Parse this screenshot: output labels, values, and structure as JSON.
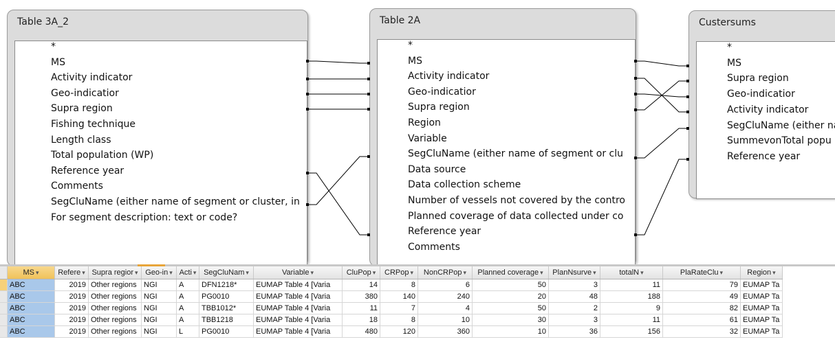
{
  "tables": [
    {
      "title": "Table 3A_2",
      "fields": [
        "*",
        "MS",
        "Activity indicator",
        "Geo-indicatior",
        "Supra region",
        "Fishing technique",
        "Length class",
        "Total population (WP)",
        "Reference year",
        "Comments",
        "SegCluName (either name of segment or cluster, in",
        "For segment description: text or code?"
      ]
    },
    {
      "title": "Table 2A",
      "fields": [
        "*",
        "MS",
        "Activity indicator",
        "Geo-indicatior",
        "Supra region",
        "Region",
        "Variable",
        "SegCluName (either name of segment or clu",
        "Data source",
        "Data collection scheme",
        "Number of vessels not covered by the contro",
        "Planned coverage of data collected under co",
        "Reference year",
        "Comments"
      ]
    },
    {
      "title": "Custersums",
      "fields": [
        "*",
        "MS",
        "Supra region",
        "Geo-indicatior",
        "Activity indicator",
        "SegCluName (either na",
        "SummevonTotal popu",
        "Reference year"
      ]
    }
  ],
  "grid": {
    "columns": [
      {
        "label": "MS"
      },
      {
        "label": "Refere"
      },
      {
        "label": "Supra regior"
      },
      {
        "label": "Geo-in"
      },
      {
        "label": "Acti"
      },
      {
        "label": "SegCluNam"
      },
      {
        "label": "Variable"
      },
      {
        "label": "CluPop"
      },
      {
        "label": "CRPop"
      },
      {
        "label": "NonCRPop"
      },
      {
        "label": "Planned coverage"
      },
      {
        "label": "PlanNsurve"
      },
      {
        "label": "totalN"
      },
      {
        "label": "PlaRateClu"
      },
      {
        "label": "Region"
      }
    ],
    "rows": [
      [
        "ABC",
        "2019",
        "Other regions",
        "NGI",
        "A",
        "DFN1218*",
        "EUMAP Table 4  [Varia",
        "14",
        "8",
        "6",
        "50",
        "3",
        "11",
        "79",
        "EUMAP Ta"
      ],
      [
        "ABC",
        "2019",
        "Other regions",
        "NGI",
        "A",
        "PG0010",
        "EUMAP Table 4  [Varia",
        "380",
        "140",
        "240",
        "20",
        "48",
        "188",
        "49",
        "EUMAP Ta"
      ],
      [
        "ABC",
        "2019",
        "Other regions",
        "NGI",
        "A",
        "TBB1012*",
        "EUMAP Table 4  [Varia",
        "11",
        "7",
        "4",
        "50",
        "2",
        "9",
        "82",
        "EUMAP Ta"
      ],
      [
        "ABC",
        "2019",
        "Other regions",
        "NGI",
        "A",
        "TBB1218",
        "EUMAP Table 4  [Varia",
        "18",
        "8",
        "10",
        "30",
        "3",
        "11",
        "61",
        "EUMAP Ta"
      ],
      [
        "ABC",
        "2019",
        "Other regions",
        "NGI",
        "L",
        "PG0010",
        "EUMAP Table 4  [Varia",
        "480",
        "120",
        "360",
        "10",
        "36",
        "156",
        "32",
        "EUMAP Ta"
      ]
    ]
  }
}
